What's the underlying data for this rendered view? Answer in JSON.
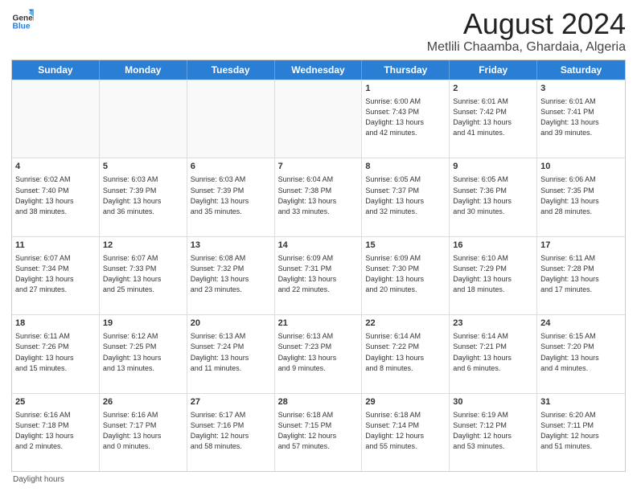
{
  "header": {
    "logo_line1": "General",
    "logo_line2": "Blue",
    "main_title": "August 2024",
    "subtitle": "Metlili Chaamba, Ghardaia, Algeria"
  },
  "calendar": {
    "days_of_week": [
      "Sunday",
      "Monday",
      "Tuesday",
      "Wednesday",
      "Thursday",
      "Friday",
      "Saturday"
    ],
    "rows": [
      [
        {
          "day": "",
          "info": ""
        },
        {
          "day": "",
          "info": ""
        },
        {
          "day": "",
          "info": ""
        },
        {
          "day": "",
          "info": ""
        },
        {
          "day": "1",
          "info": "Sunrise: 6:00 AM\nSunset: 7:43 PM\nDaylight: 13 hours\nand 42 minutes."
        },
        {
          "day": "2",
          "info": "Sunrise: 6:01 AM\nSunset: 7:42 PM\nDaylight: 13 hours\nand 41 minutes."
        },
        {
          "day": "3",
          "info": "Sunrise: 6:01 AM\nSunset: 7:41 PM\nDaylight: 13 hours\nand 39 minutes."
        }
      ],
      [
        {
          "day": "4",
          "info": "Sunrise: 6:02 AM\nSunset: 7:40 PM\nDaylight: 13 hours\nand 38 minutes."
        },
        {
          "day": "5",
          "info": "Sunrise: 6:03 AM\nSunset: 7:39 PM\nDaylight: 13 hours\nand 36 minutes."
        },
        {
          "day": "6",
          "info": "Sunrise: 6:03 AM\nSunset: 7:39 PM\nDaylight: 13 hours\nand 35 minutes."
        },
        {
          "day": "7",
          "info": "Sunrise: 6:04 AM\nSunset: 7:38 PM\nDaylight: 13 hours\nand 33 minutes."
        },
        {
          "day": "8",
          "info": "Sunrise: 6:05 AM\nSunset: 7:37 PM\nDaylight: 13 hours\nand 32 minutes."
        },
        {
          "day": "9",
          "info": "Sunrise: 6:05 AM\nSunset: 7:36 PM\nDaylight: 13 hours\nand 30 minutes."
        },
        {
          "day": "10",
          "info": "Sunrise: 6:06 AM\nSunset: 7:35 PM\nDaylight: 13 hours\nand 28 minutes."
        }
      ],
      [
        {
          "day": "11",
          "info": "Sunrise: 6:07 AM\nSunset: 7:34 PM\nDaylight: 13 hours\nand 27 minutes."
        },
        {
          "day": "12",
          "info": "Sunrise: 6:07 AM\nSunset: 7:33 PM\nDaylight: 13 hours\nand 25 minutes."
        },
        {
          "day": "13",
          "info": "Sunrise: 6:08 AM\nSunset: 7:32 PM\nDaylight: 13 hours\nand 23 minutes."
        },
        {
          "day": "14",
          "info": "Sunrise: 6:09 AM\nSunset: 7:31 PM\nDaylight: 13 hours\nand 22 minutes."
        },
        {
          "day": "15",
          "info": "Sunrise: 6:09 AM\nSunset: 7:30 PM\nDaylight: 13 hours\nand 20 minutes."
        },
        {
          "day": "16",
          "info": "Sunrise: 6:10 AM\nSunset: 7:29 PM\nDaylight: 13 hours\nand 18 minutes."
        },
        {
          "day": "17",
          "info": "Sunrise: 6:11 AM\nSunset: 7:28 PM\nDaylight: 13 hours\nand 17 minutes."
        }
      ],
      [
        {
          "day": "18",
          "info": "Sunrise: 6:11 AM\nSunset: 7:26 PM\nDaylight: 13 hours\nand 15 minutes."
        },
        {
          "day": "19",
          "info": "Sunrise: 6:12 AM\nSunset: 7:25 PM\nDaylight: 13 hours\nand 13 minutes."
        },
        {
          "day": "20",
          "info": "Sunrise: 6:13 AM\nSunset: 7:24 PM\nDaylight: 13 hours\nand 11 minutes."
        },
        {
          "day": "21",
          "info": "Sunrise: 6:13 AM\nSunset: 7:23 PM\nDaylight: 13 hours\nand 9 minutes."
        },
        {
          "day": "22",
          "info": "Sunrise: 6:14 AM\nSunset: 7:22 PM\nDaylight: 13 hours\nand 8 minutes."
        },
        {
          "day": "23",
          "info": "Sunrise: 6:14 AM\nSunset: 7:21 PM\nDaylight: 13 hours\nand 6 minutes."
        },
        {
          "day": "24",
          "info": "Sunrise: 6:15 AM\nSunset: 7:20 PM\nDaylight: 13 hours\nand 4 minutes."
        }
      ],
      [
        {
          "day": "25",
          "info": "Sunrise: 6:16 AM\nSunset: 7:18 PM\nDaylight: 13 hours\nand 2 minutes."
        },
        {
          "day": "26",
          "info": "Sunrise: 6:16 AM\nSunset: 7:17 PM\nDaylight: 13 hours\nand 0 minutes."
        },
        {
          "day": "27",
          "info": "Sunrise: 6:17 AM\nSunset: 7:16 PM\nDaylight: 12 hours\nand 58 minutes."
        },
        {
          "day": "28",
          "info": "Sunrise: 6:18 AM\nSunset: 7:15 PM\nDaylight: 12 hours\nand 57 minutes."
        },
        {
          "day": "29",
          "info": "Sunrise: 6:18 AM\nSunset: 7:14 PM\nDaylight: 12 hours\nand 55 minutes."
        },
        {
          "day": "30",
          "info": "Sunrise: 6:19 AM\nSunset: 7:12 PM\nDaylight: 12 hours\nand 53 minutes."
        },
        {
          "day": "31",
          "info": "Sunrise: 6:20 AM\nSunset: 7:11 PM\nDaylight: 12 hours\nand 51 minutes."
        }
      ]
    ]
  },
  "footer": {
    "note": "Daylight hours"
  }
}
